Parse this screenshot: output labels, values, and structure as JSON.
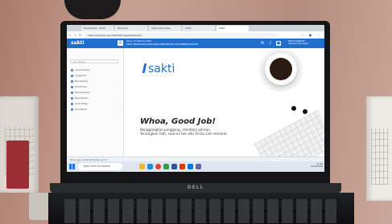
{
  "browser": {
    "tabs": [
      {
        "label": "Dashboard - Sakti"
      },
      {
        "label": "Bantuan"
      },
      {
        "label": "Sakti Kemenkeu"
      },
      {
        "label": "Sakti"
      },
      {
        "label": "Sakti"
      }
    ],
    "active_tab_index": 4,
    "address": "sakti.kemenkeu.go.id/#/sakti-app/dashboard"
  },
  "app_header": {
    "logo": "sakti",
    "notice_line1": "Senin, 27 Februari 2023",
    "notice_line2": "SAKTI PENGIRIMAN ANGGARAN PENERIMAAN DAN KEBENDAHARAAN",
    "user_name": "REKAP MANDIRI",
    "user_role": "Operator Keuangan"
  },
  "sidebar": {
    "search_placeholder": "Cari Modul",
    "items": [
      {
        "label": "Administrasi"
      },
      {
        "label": "Anggaran"
      },
      {
        "label": "Bendahara"
      },
      {
        "label": "Komitmen"
      },
      {
        "label": "Pembayaran"
      },
      {
        "label": "Persediaan"
      },
      {
        "label": "Aset Tetap"
      },
      {
        "label": "Akuntansi"
      }
    ]
  },
  "main": {
    "brand_logo": "sakti",
    "headline": "Whoa, Good Job!",
    "subtext_line1": "Renggangkan pinggang, rehatkan pikiran.",
    "subtext_line2": "Tenangkan hati, saat ini tak ada To-Do-List menanti."
  },
  "status_bar": {
    "text": "Menunggu sakti.kemenkeu.go.id..."
  },
  "taskbar": {
    "search_placeholder": "Type here to search",
    "tray_time": "11:52",
    "tray_date": "27/02/2023"
  },
  "laptop": {
    "brand": "DELL"
  },
  "colors": {
    "accent": "#1f6fd1",
    "header": "#1f6fd1"
  }
}
